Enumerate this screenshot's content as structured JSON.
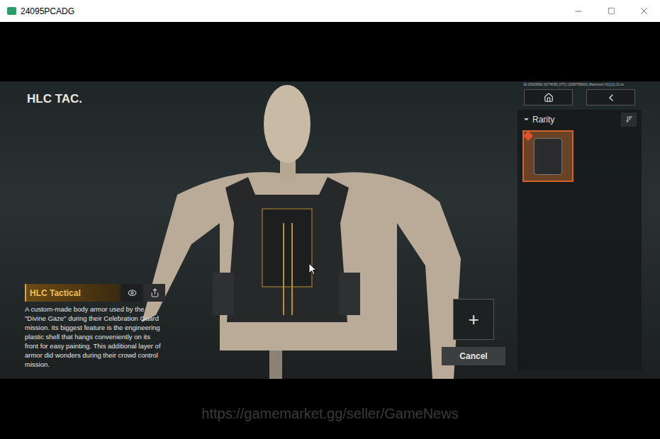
{
  "window": {
    "title": "24095PCADG"
  },
  "screen": {
    "title": "HLC TAC.",
    "debug_info": "1E:2062966E (0274035) (IITC) (2080795820) (Maximum) 6(1)(1)-21:ce"
  },
  "filter": {
    "label": "Rarity",
    "expanded": true
  },
  "items": [
    {
      "name": "HLC Tactical",
      "selected": true
    }
  ],
  "item_detail": {
    "name": "HLC Tactical",
    "description": "A custom-made body armor used by the \"Divine Gaze\" during their Celebration Guard mission. Its biggest feature is the engineering plastic shell that hangs conveniently on its front for easy painting. This additional layer of armor did wonders during their crowd control mission."
  },
  "add_button": {
    "label": "+"
  },
  "cancel_button": {
    "label": "Cancel"
  },
  "watermark": "https://gamemarket.gg/seller/GameNews"
}
